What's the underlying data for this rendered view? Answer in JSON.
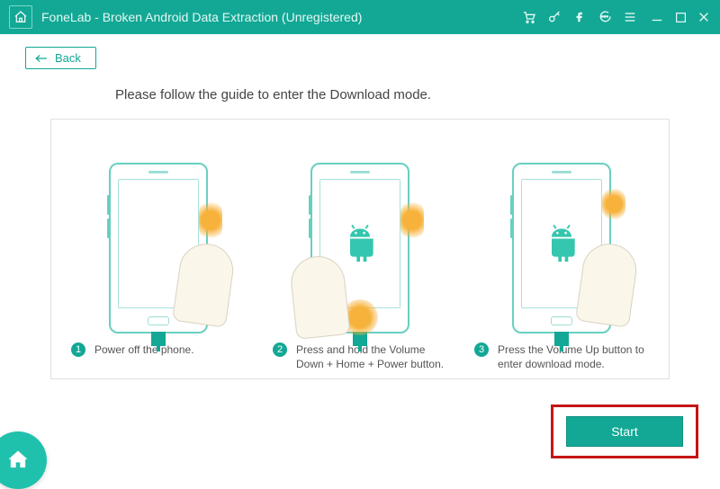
{
  "titlebar": {
    "title": "FoneLab - Broken Android Data Extraction (Unregistered)"
  },
  "back_label": "Back",
  "instruction": "Please follow the guide to enter the Download mode.",
  "steps": [
    {
      "num": "1",
      "desc": "Power off the phone."
    },
    {
      "num": "2",
      "desc": "Press and hold the Volume Down + Home + Power button."
    },
    {
      "num": "3",
      "desc": "Press the Volume Up button to enter download mode."
    }
  ],
  "start_label": "Start"
}
